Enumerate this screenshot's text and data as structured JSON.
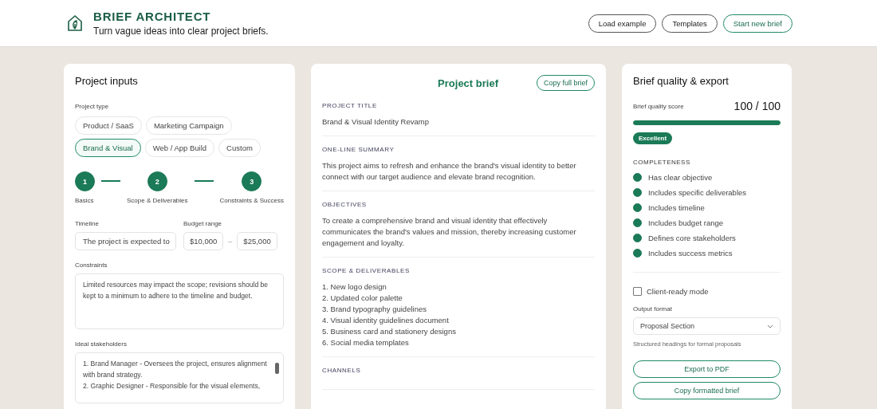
{
  "header": {
    "title": "BRIEF ARCHITECT",
    "subtitle": "Turn vague ideas into clear project briefs.",
    "buttons": [
      {
        "label": "Load example",
        "primary": false
      },
      {
        "label": "Templates",
        "primary": false
      },
      {
        "label": "Start new brief",
        "primary": true
      }
    ]
  },
  "inputs": {
    "title": "Project inputs",
    "project_type_label": "Project type",
    "project_types": [
      {
        "label": "Product / SaaS",
        "selected": false
      },
      {
        "label": "Marketing Campaign",
        "selected": false
      },
      {
        "label": "Brand & Visual",
        "selected": true
      },
      {
        "label": "Web / App Build",
        "selected": false
      },
      {
        "label": "Custom",
        "selected": false
      }
    ],
    "steps": [
      {
        "number": "1",
        "label": "Basics",
        "done": true
      },
      {
        "number": "2",
        "label": "Scope & Deliverables",
        "done": true
      },
      {
        "number": "3",
        "label": "Constraints & Success",
        "done": true
      }
    ],
    "timeline_label": "Timeline",
    "timeline_value": "The project is expected to",
    "budget_label": "Budget range",
    "budget_min": "$10,000",
    "budget_sep": "–",
    "budget_max": "$25,000",
    "constraints_label": "Constraints",
    "constraints_value": "Limited resources may impact the scope; revisions should be kept to a minimum to adhere to the timeline and budget.",
    "stakeholders_label": "Ideal stakeholders",
    "stakeholders_lines": [
      "1. Brand Manager - Oversees the project, ensures alignment with brand strategy.",
      "2. Graphic Designer - Responsible for the visual elements,"
    ]
  },
  "brief": {
    "title": "Project brief",
    "copy_button": "Copy full brief",
    "sections": [
      {
        "heading": "PROJECT TITLE",
        "kind": "text",
        "text": "Brand & Visual Identity Revamp"
      },
      {
        "heading": "ONE-LINE SUMMARY",
        "kind": "text",
        "text": "This project aims to refresh and enhance the brand's visual identity to better connect with our target audience and elevate brand recognition."
      },
      {
        "heading": "OBJECTIVES",
        "kind": "text",
        "text": "To create a comprehensive brand and visual identity that effectively communicates the brand's values and mission, thereby increasing customer engagement and loyalty."
      },
      {
        "heading": "SCOPE & DELIVERABLES",
        "kind": "list",
        "items": [
          "1. New logo design",
          "2. Updated color palette",
          "3. Brand typography guidelines",
          "4. Visual identity guidelines document",
          "5. Business card and stationery designs",
          "6. Social media templates"
        ]
      },
      {
        "heading": "CHANNELS",
        "kind": "heading"
      }
    ]
  },
  "quality": {
    "title": "Brief quality & export",
    "score_label": "Brief quality score",
    "score": "100 / 100",
    "level": 1.0,
    "badge": "Excellent",
    "completeness_label": "COMPLETENESS",
    "checks": [
      {
        "label": "Has clear objective",
        "done": true
      },
      {
        "label": "Includes specific deliverables",
        "done": true
      },
      {
        "label": "Includes timeline",
        "done": true
      },
      {
        "label": "Includes budget range",
        "done": true
      },
      {
        "label": "Defines core stakeholders",
        "done": true
      },
      {
        "label": "Includes success metrics",
        "done": true
      }
    ],
    "client_ready": {
      "label": "Client-ready mode",
      "checked": false
    },
    "output_format_label": "Output format",
    "output_format": "Proposal Section",
    "output_hint": "Structured headings for formal proposals",
    "buttons": [
      "Export to PDF",
      "Copy formatted brief"
    ]
  }
}
